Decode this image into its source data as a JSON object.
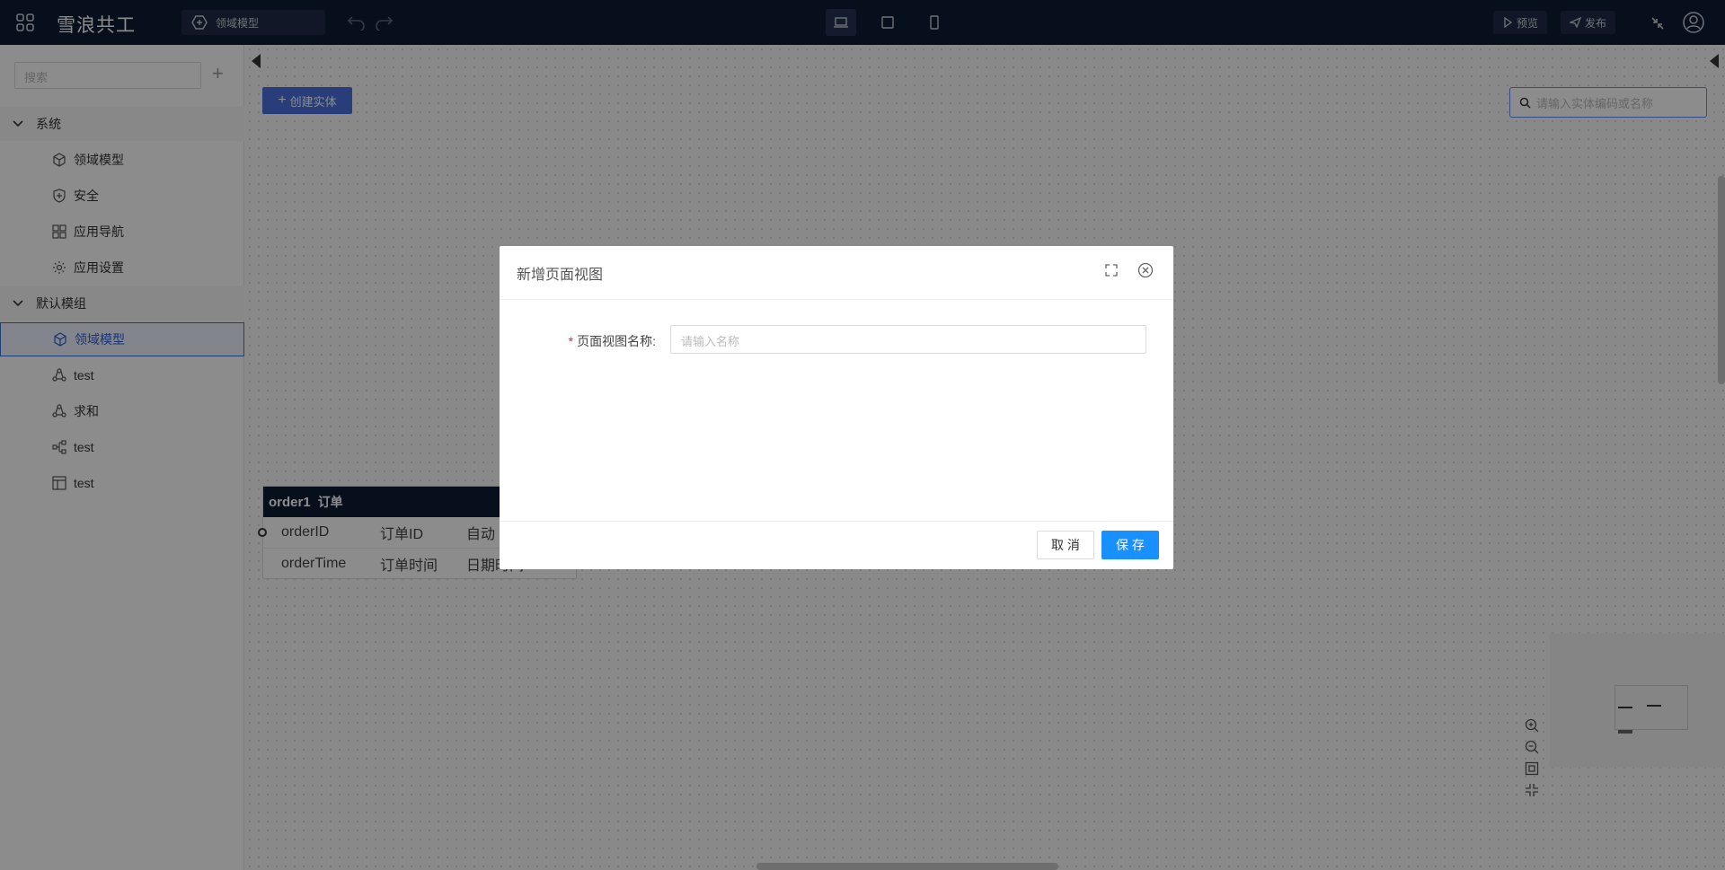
{
  "app": {
    "brand": "雪浪共工",
    "breadcrumb": "领域模型"
  },
  "toolbar": {
    "preview": "预览",
    "publish": "发布"
  },
  "sidebar": {
    "search_placeholder": "搜索",
    "groups": [
      {
        "label": "系统",
        "items": [
          {
            "label": "领域模型",
            "icon": "cube-icon"
          },
          {
            "label": "安全",
            "icon": "shield-icon"
          },
          {
            "label": "应用导航",
            "icon": "grid-icon"
          },
          {
            "label": "应用设置",
            "icon": "gear-icon"
          }
        ]
      },
      {
        "label": "默认模组",
        "items": [
          {
            "label": "领域模型",
            "icon": "cube-icon",
            "selected": true
          },
          {
            "label": "test",
            "icon": "process-icon"
          },
          {
            "label": "求和",
            "icon": "process-icon"
          },
          {
            "label": "test",
            "icon": "flow-icon"
          },
          {
            "label": "test",
            "icon": "table-icon"
          }
        ]
      }
    ]
  },
  "canvas": {
    "create_button": "创建实体",
    "entity_search_placeholder": "请输入实体编码或名称",
    "entity": {
      "code": "order1",
      "name": "订单",
      "rows": [
        {
          "field": "orderID",
          "label": "订单ID",
          "type": "自动"
        },
        {
          "field": "orderTime",
          "label": "订单时间",
          "type": "日期时间"
        }
      ]
    }
  },
  "dialog": {
    "title": "新增页面视图",
    "field_label": "页面视图名称:",
    "field_required_mark": "*",
    "field_placeholder": "请输入名称",
    "cancel": "取 消",
    "save": "保 存"
  }
}
